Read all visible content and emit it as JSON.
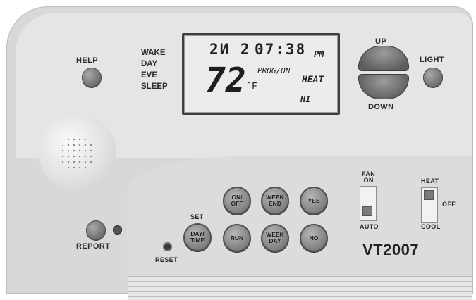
{
  "left_buttons": {
    "help": "HELP",
    "report": "REPORT"
  },
  "periods": [
    "WAKE",
    "DAY",
    "EVE",
    "SLEEP"
  ],
  "display": {
    "day": "2И 2",
    "time": "07:38",
    "ampm": "PM",
    "temperature": "72",
    "unit": "°F",
    "program": "PROG/ON",
    "mode": "HEAT",
    "fan_speed": "HI"
  },
  "right_buttons": {
    "up": "UP",
    "down": "DOWN",
    "light": "LIGHT"
  },
  "keypad": {
    "set_label": "SET",
    "day_time": [
      "DAY/",
      "TIME"
    ],
    "on_off": [
      "ON/",
      "OFF"
    ],
    "run": "RUN",
    "week_end": [
      "WEEK",
      "END"
    ],
    "week_day": [
      "WEEK",
      "DAY"
    ],
    "yes": "YES",
    "no": "NO",
    "reset": "RESET"
  },
  "fan_switch": {
    "top": [
      "FAN",
      "ON"
    ],
    "bottom": "AUTO"
  },
  "mode_switch": {
    "top": "HEAT",
    "middle": "OFF",
    "bottom": "COOL"
  },
  "model": "VT2007"
}
